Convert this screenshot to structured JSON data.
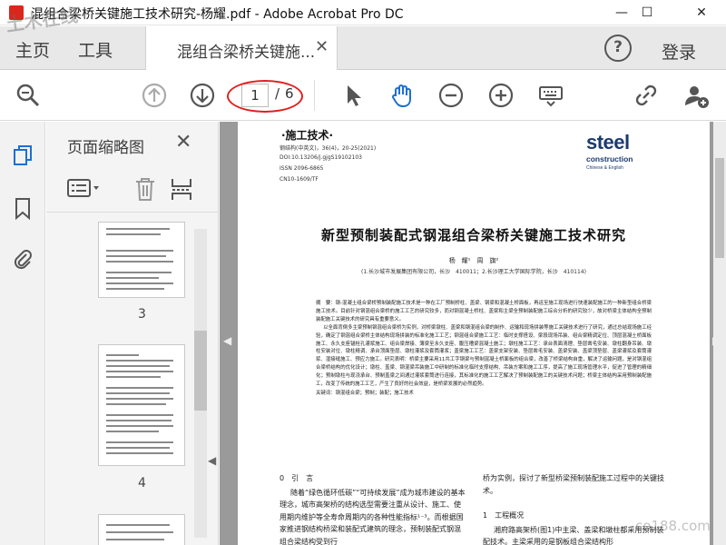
{
  "window": {
    "title": "混组合梁桥关键施工技术研究-杨耀.pdf - Adobe Acrobat Pro DC",
    "minimize": "—",
    "maximize": "☐",
    "close": "✕"
  },
  "menubar": {
    "home": "主页",
    "tools": "工具",
    "doc_tab": "混组合梁桥关键施...",
    "doc_tab_close": "✕",
    "help": "?",
    "login": "登录"
  },
  "toolbar": {
    "current_page": "1",
    "page_sep": "/",
    "total_pages": "6"
  },
  "thumbnail_pane": {
    "title": "页面缩略图",
    "close": "✕",
    "thumbs": [
      {
        "label": "3"
      },
      {
        "label": "4"
      }
    ]
  },
  "document": {
    "section": "·施工技术·",
    "meta": [
      "钢结构(中英文)，36(4)，20-25(2021)",
      "DOI:10.13206/j.gjgS19102103",
      "ISSN 2096-6865",
      "CN10-1609/TF"
    ],
    "logo": {
      "word1": "steel",
      "word2": "construction",
      "sub": "Chinese & English"
    },
    "title": "新型预制装配式钢混组合梁桥关键施工技术研究",
    "authors": "杨　耀¹　周　旗²",
    "affiliation": "(1.长沙城市发展集团有限公司，长沙　410011；2.长沙理工大学国际学院，长沙　410114)",
    "abstract": "摘　要：钢-混凝土组合梁桥预制装配施工技术是一种在工厂预制桥柱、盖梁、钢梁和混凝土桥面板，再运至施工现场进行快速装配施工的一种新型组合桥梁施工技术。目前针对钢混组合梁桥的施工工艺的研究较多，而对钢混凝土桥柱、盖梁和主梁全预制装配施工综合分析的研究较少，故对桥梁主体结构全预制装配施工关键技术的研究具有重要意义。",
    "abstract2": "以全面背倒多主梁预制钢混组合梁桥为实例，对桥梁墩柱、盖梁和钢混组合梁的制作、运输和现场拼装等施工关键技术进行了研究，通过总结现场施工经验，确定了钢混组合梁桥主体结构现场拼装的标准化施工工艺；钢混组合梁施工工艺：临时支撑搭设、梁段现场吊装、组合梁精调定位、顶层混凝土桥面板施工、永久支座锚栓孔灌浆施工、组合梁焊接、薄梁至永久支座、腹压槽梁混凝土施工；墩柱施工工艺：承台表面清理、垫层凿毛安装、墩柱翻身吊装、墩柱安装对位、墩柱精调、承台顶面垫层、墩柱灌浆及套筒灌浆；盖梁施工工艺：盖梁支架安装、垫层凿毛安装、盖梁安装、盖梁顶垫层、盖梁灌浆及套筒灌浆、湿接缝施工、预应力施工。研究表明：桥梁主要采用11共工字钢梁与预制混凝土桥面板的组合梁，改善了桥梁结构自重，解决了运输问题，是对钢混组合梁桥结构的优化设计；墩柱、盖梁、钢混梁吊装施工中研制的标准化临时支撑结构、吊装方案和施工工序，提高了施工现场管理水平，促进了管理的精细化；预制墩柱与现浇承台、预制盖梁之间通过灌浆套筒进行连接，其标准化的施工工艺解决了预制装配施工的关键技术问题；桥梁主体结构采用预制装配施工，改变了传统的施工工艺，产生了良好的社会效益，是桥梁发展的必然趋势。",
    "keywords": "关键词：钢混组合梁；预制；装配；施工技术",
    "left_col_head": "0　引　言",
    "left_col_text": "随着“绿色循环低碳”“可持续发展”成为城市建设的基本理念，城市高架桥的结构选型需要注重从设计、施工、使用期内维护等全寿命周期内的各种性能指标¹⁻³。而根据国家推进钢结构桥梁和装配式建筑的理念，预制装配式钢混组合梁结构受到行",
    "right_col_text1": "桥为实例，探讨了新型桥梁预制装配施工过程中的关键技术。",
    "right_col_head": "1　工程概况",
    "right_col_text2": "湘府路高架桥(图1)中主梁、盖梁和墩柱都采用预制装配技术。主梁采用的是钢板组合梁结构形"
  },
  "watermarks": {
    "top_left": "土木在线",
    "bottom_right": "co188.com"
  }
}
